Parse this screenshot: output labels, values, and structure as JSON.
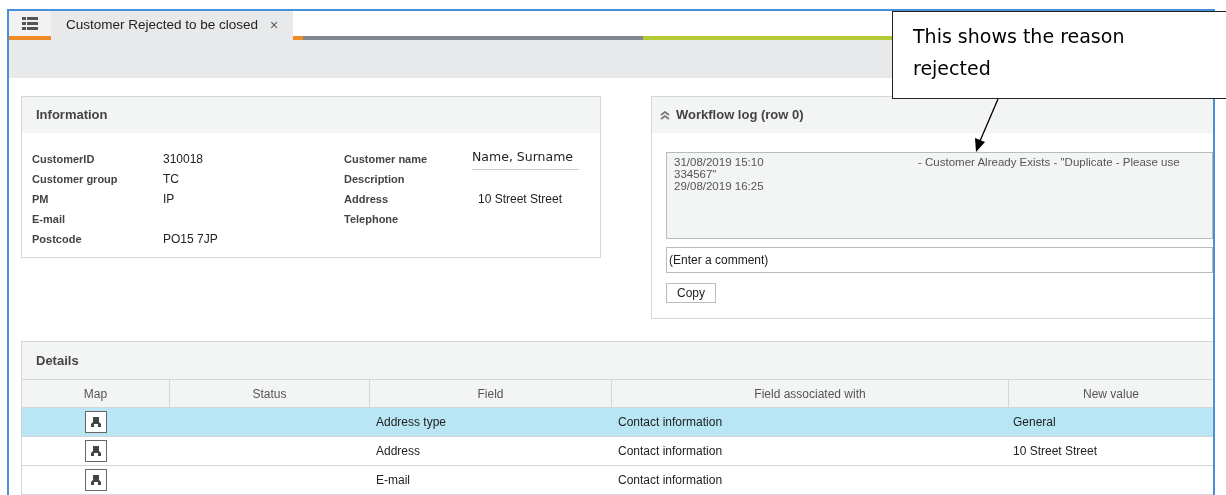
{
  "tabs": [
    {
      "label": "Customer Rejected to be closed",
      "selected": true,
      "close": "×"
    }
  ],
  "information": {
    "title": "Information",
    "left_fields": [
      {
        "label": "CustomerID",
        "value": "310018"
      },
      {
        "label": "Customer group",
        "value": "TC"
      },
      {
        "label": "PM",
        "value": "IP"
      },
      {
        "label": "E-mail"
      },
      {
        "label": "Postcode",
        "value": "PO15 7JP"
      }
    ],
    "right_fields": [
      {
        "label": "Customer name",
        "value": "Name, Surname",
        "kind": "input"
      },
      {
        "label": "Description"
      },
      {
        "label": "Address",
        "value": "10 Street Street",
        "kind": "text"
      },
      {
        "label": "Telephone"
      }
    ]
  },
  "workflow_log": {
    "title": "Workflow log (row 0)",
    "expanded": true,
    "entries": [
      {
        "time": "31/08/2019 15:10",
        "message": "- Customer Already Exists - \"Duplicate - Please use",
        "continuation": "334567\""
      },
      {
        "time": "29/08/2019 16:25"
      }
    ],
    "comment": {
      "placeholder": "(Enter a comment)"
    },
    "button": "Copy"
  },
  "details": {
    "title": "Details",
    "columns": [
      "Map",
      "Status",
      "Field",
      "Field associated with",
      "New value"
    ],
    "rows": [
      {
        "selected": true,
        "field": "Address type",
        "associated": "Contact information",
        "new_value": "General"
      },
      {
        "selected": false,
        "field": "Address",
        "associated": "Contact information",
        "new_value": "10 Street Street"
      },
      {
        "selected": false,
        "field": "E-mail",
        "associated": "Contact information"
      }
    ]
  },
  "callout": {
    "text": "This shows the reason rejected"
  }
}
